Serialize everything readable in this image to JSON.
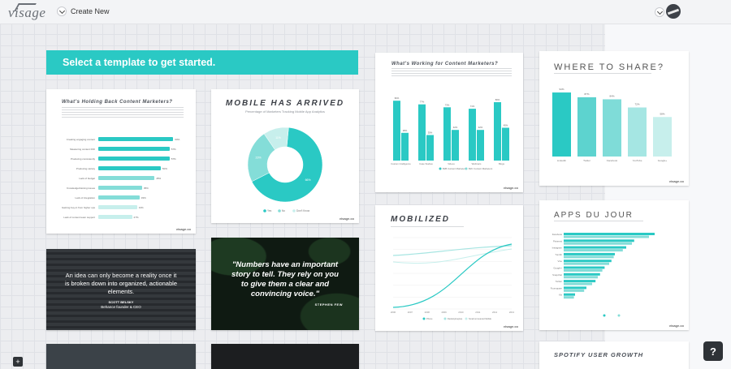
{
  "app": {
    "logo": "visage",
    "create_label": "Create New"
  },
  "banner": {
    "text": "Select a template to get started."
  },
  "colors": {
    "accent": "#2ac9c4",
    "accent_light": "#84ddd8",
    "accent_pale": "#c7efec"
  },
  "icons": {
    "help": "?",
    "plus": "+"
  },
  "cards": {
    "holding_back": {
      "title": "What's Holding Back Content Marketers?",
      "rows": [
        {
          "label": "Creating engaging content",
          "value": 60,
          "display": "60%"
        },
        {
          "label": "Measuring content ROI",
          "value": 57,
          "display": "57%"
        },
        {
          "label": "Producing consistently",
          "value": 57,
          "display": "57%"
        },
        {
          "label": "Producing variety",
          "value": 50,
          "display": "50%"
        },
        {
          "label": "Lack of budget",
          "value": 45,
          "display": "45%"
        },
        {
          "label": "Knowledge/training issues",
          "value": 35,
          "display": "35%"
        },
        {
          "label": "Lack of integration",
          "value": 33,
          "display": "33%"
        },
        {
          "label": "Gaining buy-in from higher ups",
          "value": 31,
          "display": "31%"
        },
        {
          "label": "Lack of content team support",
          "value": 27,
          "display": "27%"
        }
      ],
      "logo": "visage.co"
    },
    "mobile": {
      "title": "MOBILE HAS ARRIVED",
      "subtitle": "Percentage of Marketers Tracking Mobile App Analytics",
      "slices": [
        {
          "label": "Yes",
          "display": "66%",
          "value": 66
        },
        {
          "label": "No",
          "display": "23%",
          "value": 23
        },
        {
          "label": "Don't Know",
          "display": "11%",
          "value": 11
        }
      ],
      "logo": "visage.co"
    },
    "idea": {
      "line1": "An idea can only become a reality once it",
      "line2": "is broken down into organized, actionable",
      "line3": "elements.",
      "author": "SCOTT BELSKY",
      "role": "Behance founder & CEO"
    },
    "numbers": {
      "line1": "\"Numbers have an important",
      "line2": "story to tell. They rely on you",
      "line3": "to give them a clear and",
      "line4": "convincing voice.\"",
      "author": "STEPHEN FEW"
    },
    "working": {
      "title": "What's Working for Content Marketers?",
      "categories": [
        "Custom Intelligence",
        "Case Studies",
        "Videos",
        "Webinars",
        "Blogs"
      ],
      "series": [
        {
          "name": "B2B Content Marketers",
          "values": [
            82,
            77,
            73,
            71,
            80
          ]
        },
        {
          "name": "B2C Content Marketers",
          "values": [
            38,
            35,
            42,
            42,
            45
          ]
        }
      ],
      "logo": "visage.co"
    },
    "where": {
      "title": "WHERE TO SHARE?",
      "categories": [
        "LinkedIn",
        "Twitter",
        "Facebook",
        "YouTube",
        "Google+"
      ],
      "values": [
        94,
        87,
        84,
        72,
        58
      ],
      "display": [
        "94%",
        "87%",
        "84%",
        "72%",
        "58%"
      ],
      "logo": "visage.co"
    },
    "mobilized": {
      "title": "MOBILIZED",
      "x": [
        "2006",
        "2007",
        "2008",
        "2009",
        "2010",
        "2011",
        "2012",
        "2013"
      ],
      "legend": [
        "Phone",
        "Desktop/Laptop",
        "Small unmetered Mobile"
      ],
      "logo": "visage.co"
    },
    "apps": {
      "title": "APPS DU JOUR",
      "rows": [
        {
          "label": "Facebook",
          "values": [
            80,
            75
          ]
        },
        {
          "label": "Pinterest",
          "values": [
            62,
            60
          ]
        },
        {
          "label": "Instagram",
          "values": [
            55,
            52
          ]
        },
        {
          "label": "Tumblr",
          "values": [
            45,
            44
          ]
        },
        {
          "label": "Vine",
          "values": [
            42,
            40
          ]
        },
        {
          "label": "Google+",
          "values": [
            36,
            34
          ]
        },
        {
          "label": "Snapchat",
          "values": [
            32,
            30
          ]
        },
        {
          "label": "Twitter",
          "values": [
            28,
            25
          ]
        },
        {
          "label": "Foursquare",
          "values": [
            20,
            18
          ]
        },
        {
          "label": "Kik",
          "values": [
            10,
            9
          ]
        }
      ],
      "logo": "visage.co"
    },
    "spotify": {
      "title": "SPOTIFY USER GROWTH"
    }
  }
}
